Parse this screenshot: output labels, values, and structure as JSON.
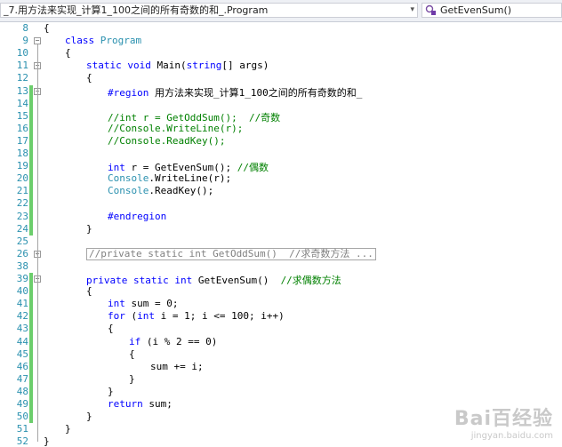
{
  "nav": {
    "left_label": "_7.用方法来实现_计算1_100之间的所有奇数的和_.Program",
    "right_label": "GetEvenSum()",
    "chevron": "▾"
  },
  "lines": [
    {
      "num": "8",
      "tokens": [
        {
          "t": "{",
          "c": "n"
        }
      ]
    },
    {
      "num": "9",
      "tokens": [
        {
          "t": "class ",
          "c": "kw"
        },
        {
          "t": "Program",
          "c": "ty"
        }
      ]
    },
    {
      "num": "10",
      "tokens": [
        {
          "t": "{",
          "c": "n"
        }
      ]
    },
    {
      "num": "11",
      "tokens": [
        {
          "t": "static void ",
          "c": "kw"
        },
        {
          "t": "Main(",
          "c": "n"
        },
        {
          "t": "string",
          "c": "kw"
        },
        {
          "t": "[] args)",
          "c": "n"
        }
      ]
    },
    {
      "num": "12",
      "tokens": [
        {
          "t": "{",
          "c": "n"
        }
      ]
    },
    {
      "num": "13",
      "tokens": [
        {
          "t": "#region ",
          "c": "kw"
        },
        {
          "t": "用方法来实现_计算1_100之间的所有奇数的和_",
          "c": "n"
        }
      ]
    },
    {
      "num": "14",
      "tokens": []
    },
    {
      "num": "15",
      "tokens": [
        {
          "t": "//int r = GetOddSum();  //奇数",
          "c": "cm"
        }
      ]
    },
    {
      "num": "16",
      "tokens": [
        {
          "t": "//Console.WriteLine(r);",
          "c": "cm"
        }
      ]
    },
    {
      "num": "17",
      "tokens": [
        {
          "t": "//Console.ReadKey();",
          "c": "cm"
        }
      ]
    },
    {
      "num": "18",
      "tokens": []
    },
    {
      "num": "19",
      "tokens": [
        {
          "t": "int",
          "c": "kw"
        },
        {
          "t": " r = GetEvenSum(); ",
          "c": "n"
        },
        {
          "t": "//偶数",
          "c": "cm"
        }
      ]
    },
    {
      "num": "20",
      "tokens": [
        {
          "t": "Console",
          "c": "ty"
        },
        {
          "t": ".WriteLine(r);",
          "c": "n"
        }
      ]
    },
    {
      "num": "21",
      "tokens": [
        {
          "t": "Console",
          "c": "ty"
        },
        {
          "t": ".ReadKey();",
          "c": "n"
        }
      ]
    },
    {
      "num": "22",
      "tokens": []
    },
    {
      "num": "23",
      "tokens": [
        {
          "t": "#endregion",
          "c": "kw"
        }
      ]
    },
    {
      "num": "24",
      "tokens": [
        {
          "t": "}",
          "c": "n"
        }
      ]
    },
    {
      "num": "25",
      "tokens": []
    },
    {
      "num": "26",
      "tokens": []
    },
    {
      "num": "38",
      "tokens": []
    },
    {
      "num": "39",
      "tokens": [
        {
          "t": "private static int ",
          "c": "kw"
        },
        {
          "t": "GetEvenSum()  ",
          "c": "n"
        },
        {
          "t": "//求偶数方法",
          "c": "cm"
        }
      ]
    },
    {
      "num": "40",
      "tokens": [
        {
          "t": "{",
          "c": "n"
        }
      ]
    },
    {
      "num": "41",
      "tokens": [
        {
          "t": "int",
          "c": "kw"
        },
        {
          "t": " sum = 0;",
          "c": "n"
        }
      ]
    },
    {
      "num": "42",
      "tokens": [
        {
          "t": "for",
          "c": "kw"
        },
        {
          "t": " (",
          "c": "n"
        },
        {
          "t": "int",
          "c": "kw"
        },
        {
          "t": " i = 1; i <= 100; i++)",
          "c": "n"
        }
      ]
    },
    {
      "num": "43",
      "tokens": [
        {
          "t": "{",
          "c": "n"
        }
      ]
    },
    {
      "num": "44",
      "tokens": [
        {
          "t": "if",
          "c": "kw"
        },
        {
          "t": " (i % 2 == 0)",
          "c": "n"
        }
      ]
    },
    {
      "num": "45",
      "tokens": [
        {
          "t": "{",
          "c": "n"
        }
      ]
    },
    {
      "num": "46",
      "tokens": [
        {
          "t": "sum += i;",
          "c": "n"
        }
      ]
    },
    {
      "num": "47",
      "tokens": [
        {
          "t": "}",
          "c": "n"
        }
      ]
    },
    {
      "num": "48",
      "tokens": [
        {
          "t": "}",
          "c": "n"
        }
      ]
    },
    {
      "num": "49",
      "tokens": [
        {
          "t": "return",
          "c": "kw"
        },
        {
          "t": " sum;",
          "c": "n"
        }
      ]
    },
    {
      "num": "50",
      "tokens": [
        {
          "t": "}",
          "c": "n"
        }
      ]
    },
    {
      "num": "51",
      "tokens": [
        {
          "t": "}",
          "c": "n"
        }
      ]
    },
    {
      "num": "52",
      "tokens": [
        {
          "t": "}",
          "c": "n"
        }
      ]
    }
  ],
  "collapsed_text": "//private static int GetOddSum()  //求奇数方法 ...",
  "watermark": {
    "logo": "Bai百经验",
    "sub": "jingyan.baidu.com"
  },
  "colors": {
    "keyword": "#0000ff",
    "type": "#2b91af",
    "comment": "#008000",
    "change_bar": "#6cce6c"
  }
}
